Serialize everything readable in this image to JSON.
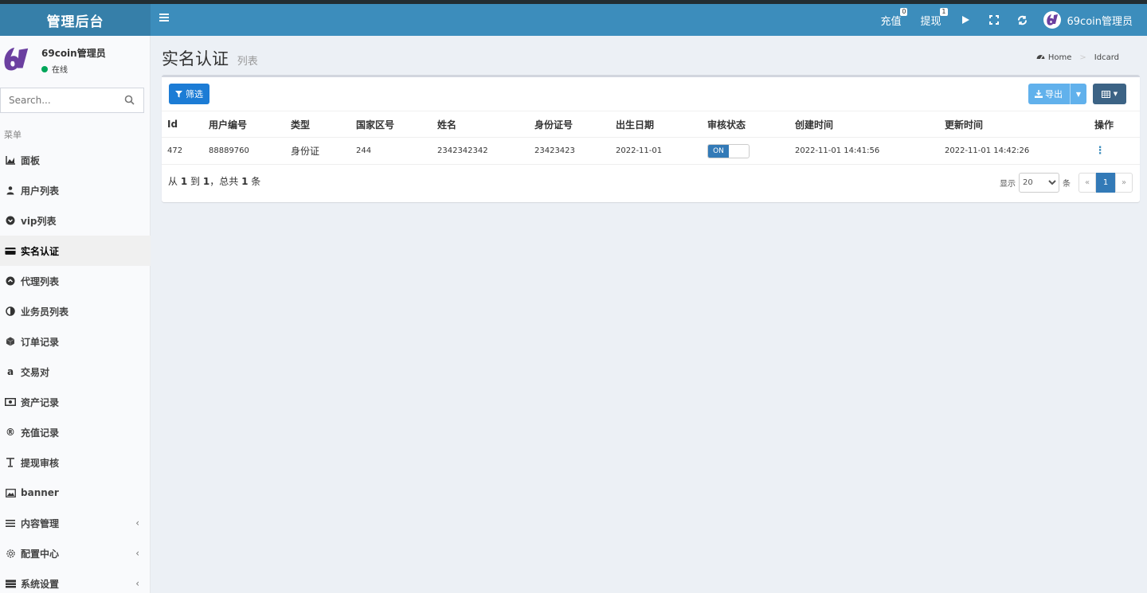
{
  "header": {
    "brand": "管理后台",
    "nav": {
      "recharge": "充值",
      "recharge_badge": "0",
      "withdraw": "提现",
      "withdraw_badge": "1",
      "user": "69coin管理员"
    }
  },
  "sidebar": {
    "user": {
      "name": "69coin管理员",
      "status": "在线"
    },
    "search_placeholder": "Search...",
    "menu_header": "菜单",
    "items": [
      {
        "label": "面板",
        "icon": "area-chart-icon"
      },
      {
        "label": "用户列表",
        "icon": "users-icon"
      },
      {
        "label": "vip列表",
        "icon": "chevron-circle-down-icon"
      },
      {
        "label": "实名认证",
        "icon": "credit-card-icon"
      },
      {
        "label": "代理列表",
        "icon": "arrow-circle-up-icon"
      },
      {
        "label": "业务员列表",
        "icon": "adjust-icon"
      },
      {
        "label": "订单记录",
        "icon": "cube-icon"
      },
      {
        "label": "交易对",
        "icon": "amazon-icon"
      },
      {
        "label": "资产记录",
        "icon": "money-icon"
      },
      {
        "label": "充值记录",
        "icon": "registered-icon"
      },
      {
        "label": "提现审核",
        "icon": "text-cursor-icon"
      },
      {
        "label": "banner",
        "icon": "image-icon"
      },
      {
        "label": "内容管理",
        "icon": "list-icon"
      },
      {
        "label": "配置中心",
        "icon": "cog-icon"
      },
      {
        "label": "系统设置",
        "icon": "server-icon"
      }
    ]
  },
  "content": {
    "title": "实名认证",
    "subtitle": "列表",
    "breadcrumb": [
      "Home",
      "Idcard"
    ]
  },
  "toolbar": {
    "filter": "筛选",
    "export": "导出"
  },
  "table": {
    "columns": [
      "Id",
      "用户编号",
      "类型",
      "国家区号",
      "姓名",
      "身份证号",
      "出生日期",
      "审核状态",
      "创建时间",
      "更新时间",
      "操作"
    ],
    "rows": [
      {
        "id": "472",
        "user_no": "88889760",
        "type": "身份证",
        "country_code": "244",
        "name": "2342342342",
        "id_number": "23423423",
        "birth_date": "2022-11-01",
        "status": "ON",
        "created": "2022-11-01 14:41:56",
        "updated": "2022-11-01 14:42:26"
      }
    ]
  },
  "pagination": {
    "from_label": "从",
    "from": "1",
    "to_label": "到",
    "to": "1",
    "total_prefix": "，总共",
    "total": "1",
    "total_suffix": "条",
    "show_label": "显示",
    "page_size": "20",
    "page_size_unit": "条",
    "prev": "«",
    "current": "1",
    "next": "»"
  },
  "colors": {
    "header": "#3c8dbc",
    "brand_bg": "#367fa9",
    "filter_btn": "#1c7cd5",
    "export_btn": "#61b1ec",
    "columns_btn": "#3c6385",
    "online": "#00a65a"
  }
}
